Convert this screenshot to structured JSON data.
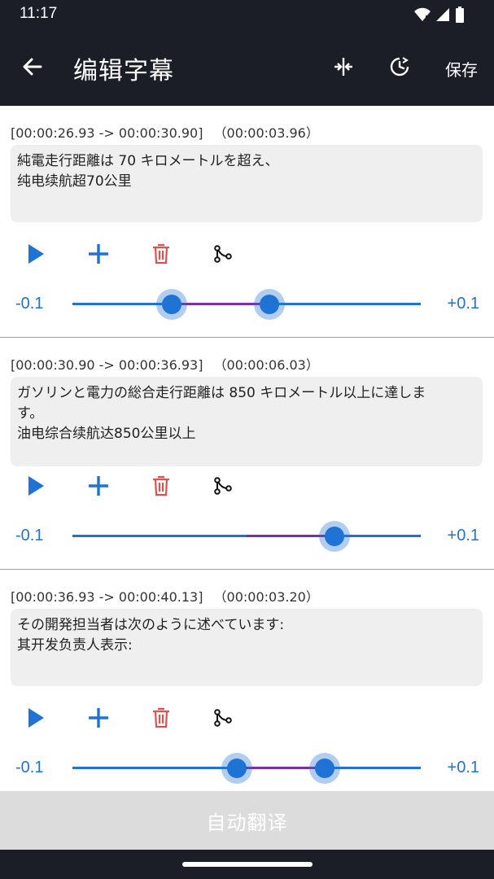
{
  "status": {
    "time": "11:17"
  },
  "app_bar": {
    "title": "编辑字幕",
    "save_label": "保存",
    "accent": "#1b1d27"
  },
  "slider": {
    "min_label": "-0.1",
    "max_label": "+0.1",
    "min": -0.1,
    "max": 0.1
  },
  "colors": {
    "primary": "#1f73d4",
    "delete": "#d9534f",
    "range": "#7b2ea8"
  },
  "subtitles": [
    {
      "range": "[00:00:26.93 -> 00:00:30.90]",
      "duration": "（00:00:03.96）",
      "lines": [
        "純電走行距離は 70 キロメートルを超え、",
        "纯电续航超70公里"
      ],
      "thumbs": [
        -0.0431,
        0.0131
      ]
    },
    {
      "range": "[00:00:30.90 -> 00:00:36.93]",
      "duration": "（00:00:06.03）",
      "lines": [
        "ガソリンと電力の総合走行距離は 850 キロメートル以上に達しま",
        "す。",
        "油电综合续航达850公里以上"
      ],
      "thumbs": [
        0.0505
      ]
    },
    {
      "range": "[00:00:36.93 -> 00:00:40.13]",
      "duration": "（00:00:03.20）",
      "lines": [
        "その開発担当者は次のように述べています:",
        "其开发负责人表示:"
      ],
      "thumbs": [
        -0.0057,
        0.0449
      ]
    }
  ],
  "bottom": {
    "auto_translate_label": "自动翻译"
  }
}
